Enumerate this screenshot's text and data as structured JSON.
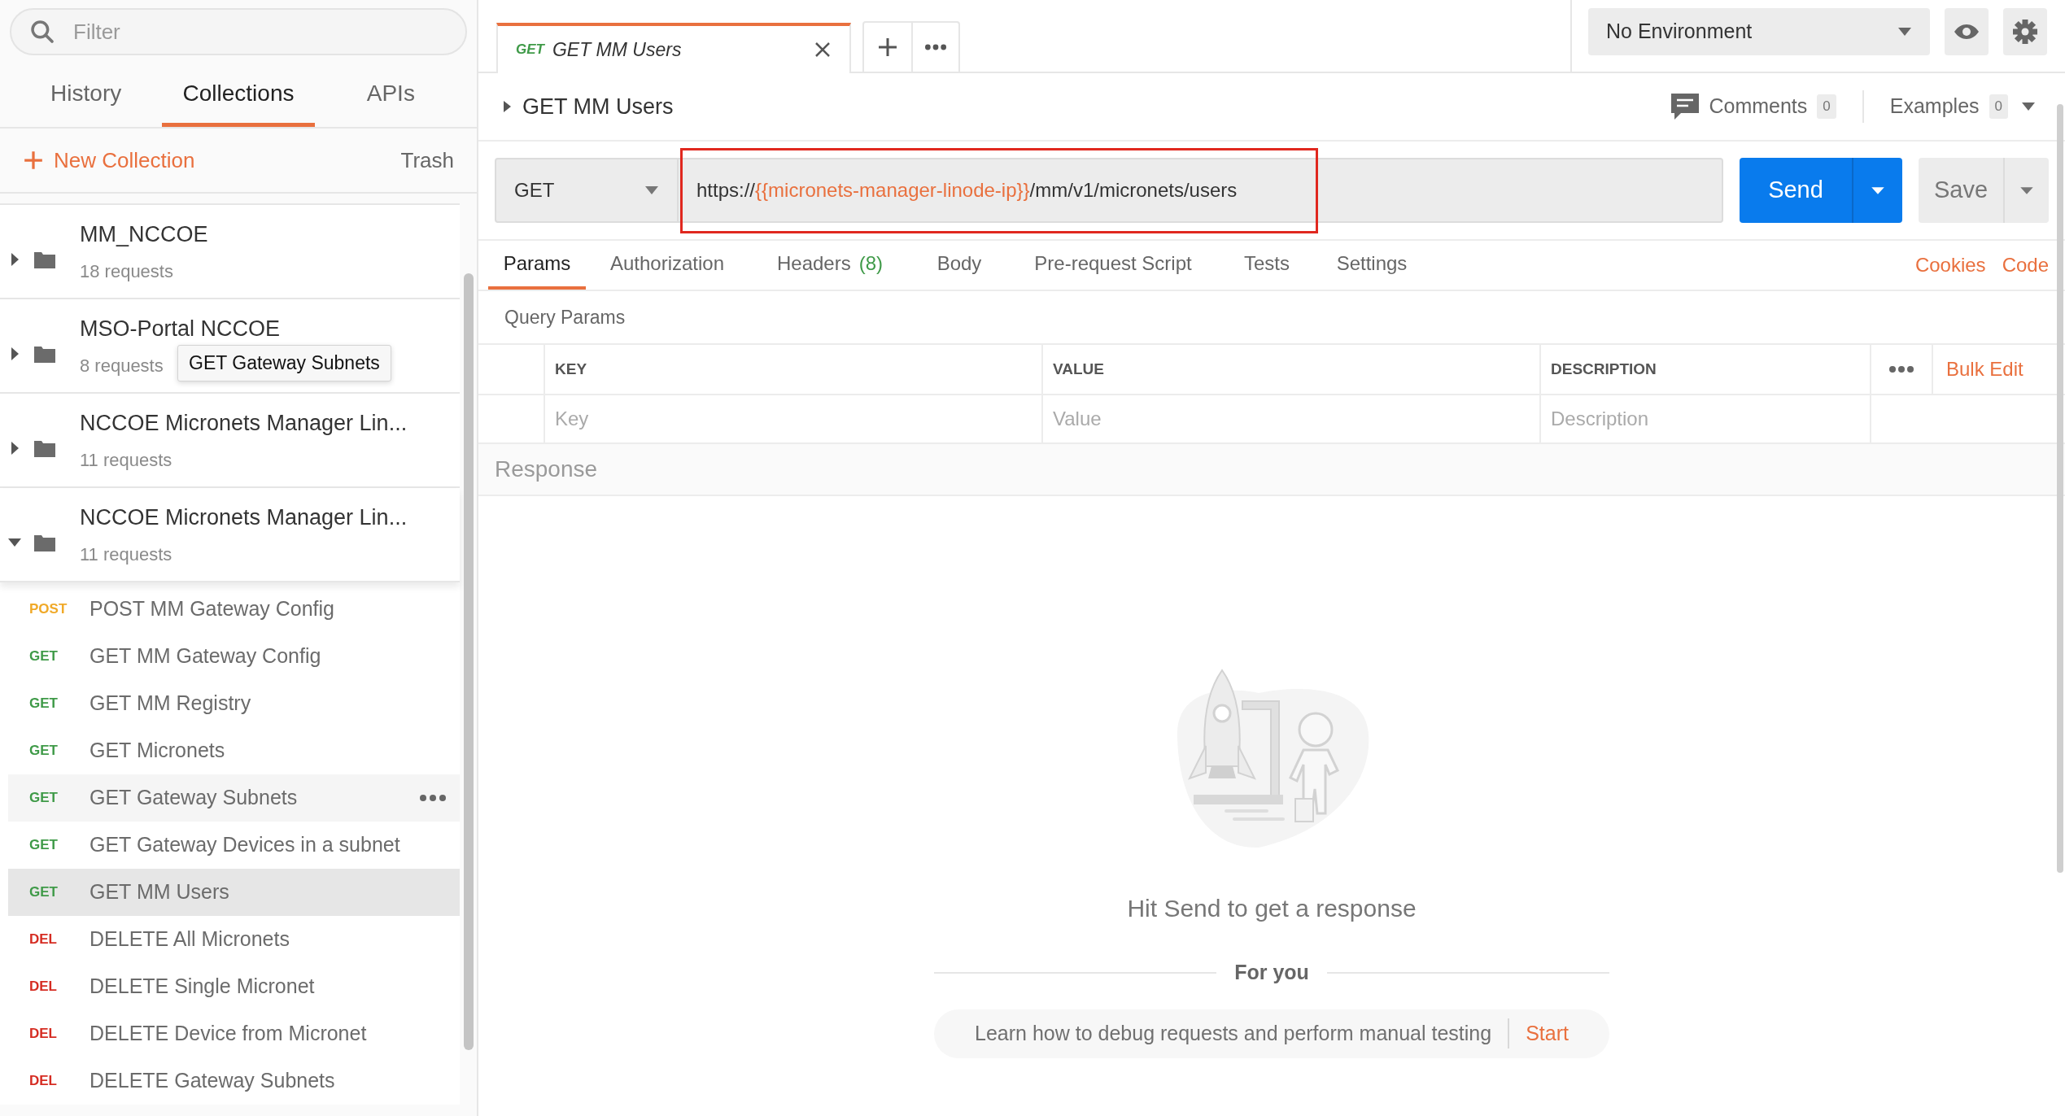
{
  "sidebar": {
    "filter": {
      "placeholder": "Filter"
    },
    "tabs": [
      {
        "label": "History",
        "selected": false
      },
      {
        "label": "Collections",
        "selected": true
      },
      {
        "label": "APIs",
        "selected": false
      }
    ],
    "new_collection": "New Collection",
    "trash": "Trash",
    "collections": [
      {
        "name": "MM_NCCOE",
        "count": "18 requests",
        "expanded": false
      },
      {
        "name": "MSO-Portal NCCOE",
        "count": "8 requests",
        "expanded": false
      },
      {
        "name": "NCCOE Micronets Manager Lin...",
        "count": "11 requests",
        "expanded": false
      },
      {
        "name": "NCCOE Micronets Manager Lin...",
        "count": "11 requests",
        "expanded": true
      }
    ],
    "requests": [
      {
        "method": "POST",
        "color": "#f0a928",
        "name": "POST MM Gateway Config",
        "selected": false,
        "hovered": false
      },
      {
        "method": "GET",
        "color": "#3f9a48",
        "name": "GET MM Gateway Config",
        "selected": false,
        "hovered": false
      },
      {
        "method": "GET",
        "color": "#3f9a48",
        "name": "GET MM Registry",
        "selected": false,
        "hovered": false
      },
      {
        "method": "GET",
        "color": "#3f9a48",
        "name": "GET Micronets",
        "selected": false,
        "hovered": false
      },
      {
        "method": "GET",
        "color": "#3f9a48",
        "name": "GET Gateway Subnets",
        "selected": false,
        "hovered": true
      },
      {
        "method": "GET",
        "color": "#3f9a48",
        "name": "GET Gateway Devices in a subnet",
        "selected": false,
        "hovered": false
      },
      {
        "method": "GET",
        "color": "#3f9a48",
        "name": "GET MM Users",
        "selected": true,
        "hovered": false
      },
      {
        "method": "DEL",
        "color": "#d52c22",
        "name": "DELETE All Micronets",
        "selected": false,
        "hovered": false
      },
      {
        "method": "DEL",
        "color": "#d52c22",
        "name": "DELETE Single Micronet",
        "selected": false,
        "hovered": false
      },
      {
        "method": "DEL",
        "color": "#d52c22",
        "name": "DELETE Device from Micronet",
        "selected": false,
        "hovered": false
      },
      {
        "method": "DEL",
        "color": "#d52c22",
        "name": "DELETE Gateway Subnets",
        "selected": false,
        "hovered": false
      }
    ],
    "tooltip": "GET Gateway Subnets"
  },
  "open_tab": {
    "method": "GET",
    "title": "GET MM Users"
  },
  "environment": "No Environment",
  "request": {
    "title": "GET MM Users",
    "comments": {
      "label": "Comments",
      "count": "0"
    },
    "examples": {
      "label": "Examples",
      "count": "0"
    },
    "method": "GET",
    "url": [
      {
        "text": "https://",
        "variable": false
      },
      {
        "text": "{{micronets-manager-linode-ip}}",
        "variable": true
      },
      {
        "text": "/mm/v1/micronets/users",
        "variable": false
      }
    ],
    "send": "Send",
    "save": "Save"
  },
  "param_tabs": [
    {
      "label": "Params",
      "selected": true
    },
    {
      "label": "Authorization",
      "selected": false
    },
    {
      "label": "Headers",
      "count": "(8)",
      "selected": false
    },
    {
      "label": "Body",
      "selected": false
    },
    {
      "label": "Pre-request Script",
      "selected": false
    },
    {
      "label": "Tests",
      "selected": false
    },
    {
      "label": "Settings",
      "selected": false
    }
  ],
  "links": [
    "Cookies",
    "Code"
  ],
  "query_params": {
    "title": "Query Params",
    "columns": [
      "KEY",
      "VALUE",
      "DESCRIPTION"
    ],
    "bulk_edit": "Bulk Edit",
    "placeholders": [
      "Key",
      "Value",
      "Description"
    ]
  },
  "response": {
    "title": "Response",
    "message": "Hit Send to get a response",
    "for_you": "For you",
    "tip": "Learn how to debug requests and perform manual testing",
    "tip_action": "Start"
  }
}
